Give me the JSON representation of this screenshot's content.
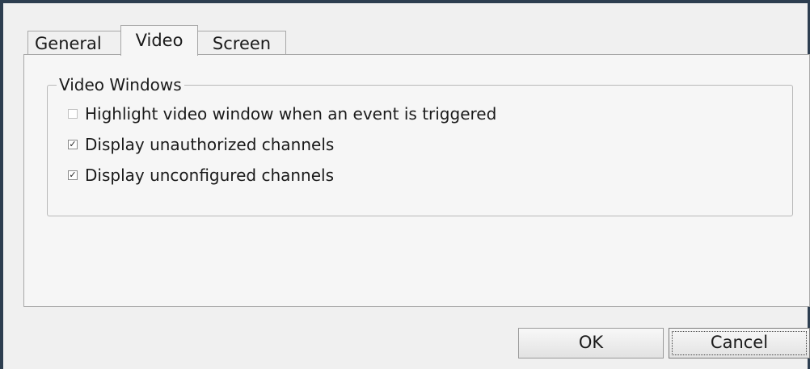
{
  "tabs": [
    {
      "label": "General",
      "active": false
    },
    {
      "label": "Video",
      "active": true
    },
    {
      "label": "Screen",
      "active": false
    }
  ],
  "video_windows": {
    "title": "Video Windows",
    "options": [
      {
        "label": "Highlight video window when an event is triggered",
        "checked": false,
        "enabled": false
      },
      {
        "label": "Display unauthorized channels",
        "checked": true,
        "enabled": true
      },
      {
        "label": "Display unconfigured channels",
        "checked": true,
        "enabled": true
      }
    ]
  },
  "buttons": {
    "ok_label": "OK",
    "cancel_label": "Cancel"
  },
  "colors": {
    "window_border": "#2d3e50",
    "background": "#f0f0f0",
    "panel": "#f6f6f6"
  }
}
